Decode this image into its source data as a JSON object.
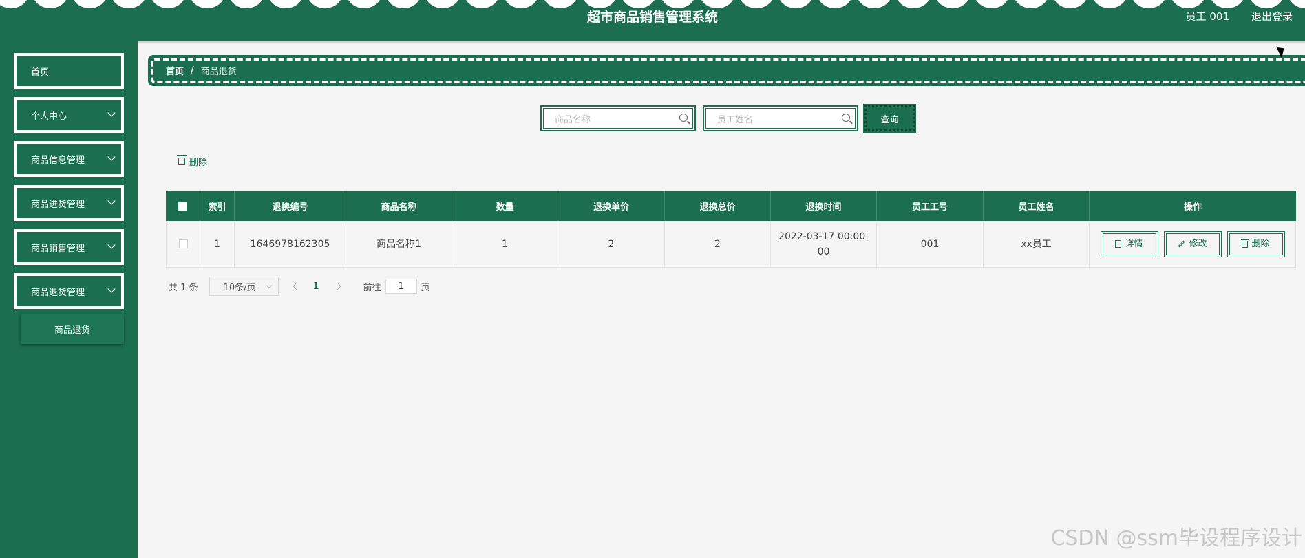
{
  "header": {
    "title": "超市商品销售管理系统",
    "user": "员工 001",
    "logout": "退出登录"
  },
  "sidebar": {
    "items": [
      {
        "label": "首页",
        "has_arrow": false
      },
      {
        "label": "个人中心",
        "has_arrow": true
      },
      {
        "label": "商品信息管理",
        "has_arrow": true
      },
      {
        "label": "商品进货管理",
        "has_arrow": true
      },
      {
        "label": "商品销售管理",
        "has_arrow": true
      },
      {
        "label": "商品退货管理",
        "has_arrow": true
      }
    ],
    "submenu": {
      "label": "商品退货"
    }
  },
  "breadcrumb": {
    "home": "首页",
    "separator": "/",
    "current": "商品退货"
  },
  "search": {
    "product_placeholder": "商品名称",
    "employee_placeholder": "员工姓名",
    "query_label": "查询"
  },
  "toolbar": {
    "delete_label": "删除"
  },
  "table": {
    "columns": [
      "索引",
      "退换编号",
      "商品名称",
      "数量",
      "退换单价",
      "退换总价",
      "退换时间",
      "员工工号",
      "员工姓名",
      "操作"
    ],
    "rows": [
      {
        "index": "1",
        "return_no": "1646978162305",
        "product_name": "商品名称1",
        "quantity": "1",
        "unit_price": "2",
        "total_price": "2",
        "return_time": "2022-03-17 00:00:00",
        "employee_id": "001",
        "employee_name": "xx员工"
      }
    ],
    "actions": {
      "detail": "详情",
      "edit": "修改",
      "delete": "删除"
    }
  },
  "pagination": {
    "total_label": "共 1 条",
    "page_size": "10条/页",
    "current_page": "1",
    "goto_label": "前往",
    "goto_value": "1",
    "goto_suffix": "页"
  },
  "watermark": "CSDN @ssm毕设程序设计",
  "colors": {
    "primary": "#1b6e50",
    "background": "#f5f5f5",
    "header_text": "#ffffff"
  }
}
